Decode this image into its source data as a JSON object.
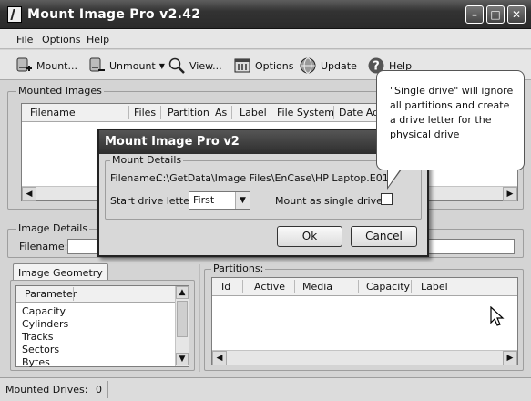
{
  "window": {
    "title": "Mount Image Pro v2.42",
    "controls": [
      "minimize-icon",
      "maximize-icon",
      "close-icon"
    ]
  },
  "menu": [
    "File",
    "Options",
    "Help"
  ],
  "toolbar": {
    "mount": "Mount...",
    "unmount": "Unmount",
    "view": "View...",
    "options": "Options",
    "update": "Update",
    "help": "Help"
  },
  "mounted_images": {
    "label": "Mounted Images",
    "columns": [
      "Filename",
      "Files",
      "Partition",
      "As",
      "Label",
      "File System",
      "Date Aq"
    ]
  },
  "image_details": {
    "label": "Image Details",
    "filename_label": "Filename:",
    "filename_value": ""
  },
  "geometry": {
    "tab": "Image Geometry",
    "column": "Parameter",
    "rows": [
      "Capacity",
      "Cylinders",
      "Tracks",
      "Sectors",
      "Bytes"
    ]
  },
  "partitions": {
    "label": "Partitions:",
    "columns": [
      "Id",
      "Active",
      "Media",
      "Capacity",
      "Label"
    ]
  },
  "dialog": {
    "title": "Mount Image Pro v2",
    "group": "Mount Details",
    "filename_label": "Filename:",
    "filename": "C:\\GetData\\Image Files\\EnCase\\HP Laptop.E01",
    "start_drive_label": "Start drive letter:",
    "start_drive_value": "First",
    "single_drive_label": "Mount as single drive:",
    "single_drive_checked": false,
    "ok": "Ok",
    "cancel": "Cancel"
  },
  "balloon": {
    "text": "\"Single drive\" will ignore all partitions and create a drive letter for the physical drive"
  },
  "status": {
    "label": "Mounted Drives:",
    "count": "0"
  }
}
